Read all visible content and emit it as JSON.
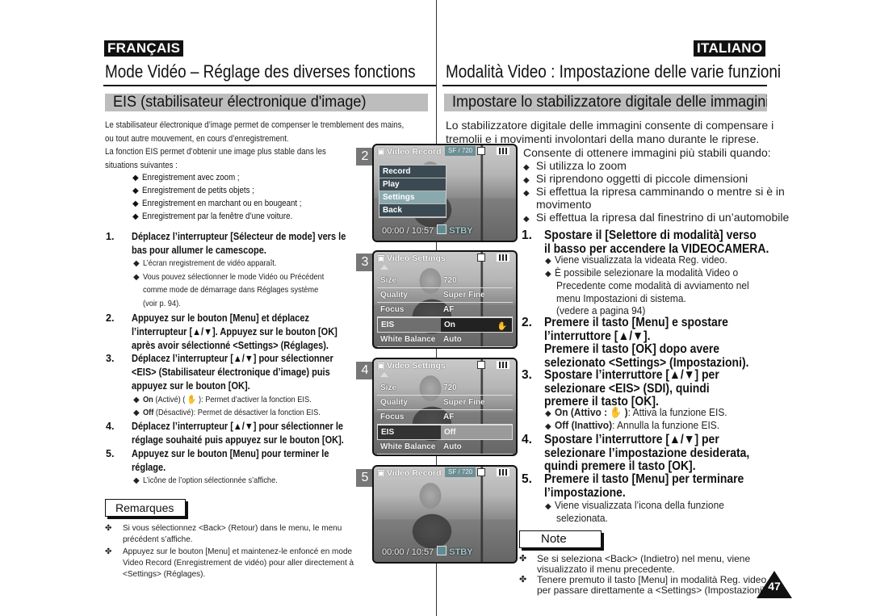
{
  "header": {
    "fr_lang": "FRANÇAIS",
    "it_lang": "ITALIANO",
    "fr_title": "Mode Vidéo – Réglage des diverses fonctions",
    "it_title": "Modalità Video : Impostazione delle varie funzioni"
  },
  "fr": {
    "section_title": "EIS (stabilisateur électronique d'image)",
    "intro": [
      "Le stabilisateur électronique d’image permet de compenser le tremblement des mains,",
      "ou tout autre mouvement, en cours d’enregistrement.",
      "La fonction EIS permet d’obtenir une image plus stable dans les",
      "situations suivantes :"
    ],
    "bullets": [
      "Enregistrement avec zoom ;",
      "Enregistrement de petits objets ;",
      "Enregistrement en marchant ou en bougeant ;",
      "Enregistrement par la fenêtre d’une voiture."
    ],
    "steps": [
      {
        "num": "1.",
        "lines": [
          "Déplacez l’interrupteur [Sélecteur de mode] vers le",
          "bas pour allumer le camescope."
        ],
        "subs": [
          "L’écran nregistrement de vidéo apparaît.",
          "Vous pouvez sélectionner le mode Vidéo ou Précédent",
          "comme mode de démarrage dans Réglages système",
          "(voir p. 94)."
        ]
      },
      {
        "num": "2.",
        "lines": [
          "Appuyez sur le bouton [Menu] et déplacez",
          "l’interrupteur [▲/▼]. Appuyez sur le bouton [OK]",
          "après avoir sélectionné <Settings> (Réglages)."
        ]
      },
      {
        "num": "3.",
        "lines": [
          "Déplacez l’interrupteur [▲/▼] pour sélectionner",
          "<EIS> (Stabilisateur électronique d’image) puis",
          "appuyez sur le bouton [OK]."
        ],
        "subs": [
          {
            "bold": "On",
            "rest": " (Activé) ( ✋ ): Permet d’activer la fonction EIS."
          },
          {
            "bold": "Off",
            "rest": " (Désactivé): Permet de désactiver la fonction EIS."
          }
        ]
      },
      {
        "num": "4.",
        "lines": [
          "Déplacez l’interrupteur [▲/▼] pour sélectionner le",
          "réglage souhaité puis appuyez sur le bouton [OK]."
        ]
      },
      {
        "num": "5.",
        "lines": [
          "Appuyez sur le bouton [Menu] pour terminer le",
          "réglage."
        ],
        "subs": [
          "L’icône de l’option sélectionnée s’affiche."
        ]
      }
    ],
    "notes_title": "Remarques",
    "notes": [
      [
        "Si vous sélectionnez <Back> (Retour) dans le menu, le menu",
        "précédent s’affiche."
      ],
      [
        "Appuyez sur le bouton [Menu] et maintenez-le enfoncé en mode",
        "Video Record (Enregistrement de vidéo) pour aller directement à",
        "<Settings> (Réglages)."
      ]
    ]
  },
  "it": {
    "section_title": "Impostare lo stabilizzatore digitale delle immagini",
    "intro": [
      "Lo stabilizzatore digitale delle immagini consente di compensare i",
      "tremolii e i movimenti involontari della mano durante le riprese."
    ],
    "intro2": "Consente di ottenere immagini più stabili quando:",
    "bullets": [
      [
        "Si utilizza lo zoom"
      ],
      [
        "Si riprendono oggetti di piccole dimensioni"
      ],
      [
        "Si effettua la ripresa camminando o mentre si è in",
        "movimento"
      ],
      [
        "Si effettua la ripresa dal finestrino di un’automobile"
      ]
    ],
    "steps": [
      {
        "num": "1.",
        "lines": [
          "Spostare il [Selettore di modalità] verso",
          "il basso per accendere la VIDEOCAMERA."
        ],
        "subs": [
          [
            "Viene visualizzata la videata Reg. video."
          ],
          [
            "È possibile selezionare la modalità Video o",
            "Precedente come modalità di avviamento nel",
            "menu Impostazioni di sistema.",
            "(vedere a pagina 94)"
          ]
        ]
      },
      {
        "num": "2.",
        "lines": [
          "Premere il tasto [Menu] e spostare",
          "l’interruttore [▲/▼].",
          "Premere il tasto [OK] dopo avere",
          "selezionato <Settings> (Impostazioni)."
        ]
      },
      {
        "num": "3.",
        "lines": [
          "Spostare l’interruttore [▲/▼] per",
          "selezionare <EIS> (SDI), quindi",
          "premere il tasto [OK]."
        ],
        "subs": [
          {
            "bold": "On (Attivo : ✋ )",
            "rest": ": Attiva la funzione EIS."
          },
          {
            "bold": "Off (Inattivo)",
            "rest": ": Annulla la funzione EIS."
          }
        ]
      },
      {
        "num": "4.",
        "lines": [
          "Spostare l’interruttore [▲/▼]  per",
          "selezionare l’impostazione desiderata,",
          "quindi premere il tasto [OK]."
        ]
      },
      {
        "num": "5.",
        "lines": [
          "Premere il tasto [Menu] per terminare",
          "l’impostazione."
        ],
        "subs": [
          [
            "Viene visualizzata l’icona della funzione",
            "selezionata."
          ]
        ]
      }
    ],
    "notes_title": "Note",
    "notes": [
      [
        "Se si seleziona <Back> (Indietro) nel menu, viene",
        "visualizzato il menu precedente."
      ],
      [
        "Tenere premuto il tasto [Menu] in modalità Reg. video",
        "per passare direttamente a <Settings> (Impostazioni)."
      ]
    ]
  },
  "screens": {
    "s2": {
      "num": "2",
      "title": "Video Record",
      "badge": "SF  /  720",
      "menu": [
        "Record",
        "Play",
        "Settings",
        "Back"
      ],
      "selected": "Settings",
      "time": "00:00 / 10:57",
      "status": "STBY"
    },
    "s3": {
      "num": "3",
      "title": "Video Settings",
      "rows": [
        {
          "label": "Size",
          "value": "720"
        },
        {
          "label": "Quality",
          "value": "Super Fine"
        },
        {
          "label": "Focus",
          "value": "AF"
        },
        {
          "label": "EIS",
          "value": "On"
        },
        {
          "label": "White Balance",
          "value": "Auto"
        }
      ]
    },
    "s4": {
      "num": "4",
      "title": "Video Settings",
      "rows": [
        {
          "label": "Size",
          "value": "720"
        },
        {
          "label": "Quality",
          "value": "Super Fine"
        },
        {
          "label": "Focus",
          "value": "AF"
        },
        {
          "label": "EIS",
          "value": "Off"
        },
        {
          "label": "White Balance",
          "value": "Auto"
        }
      ]
    },
    "s5": {
      "num": "5",
      "title": "Video Record",
      "badge": "SF  /  720",
      "time": "00:00 / 10:57",
      "status": "STBY"
    }
  },
  "page_number": "47",
  "symbols": {
    "diamond": "◆",
    "note_marker": "✤",
    "hand": "✋",
    "camera": "🎥"
  }
}
